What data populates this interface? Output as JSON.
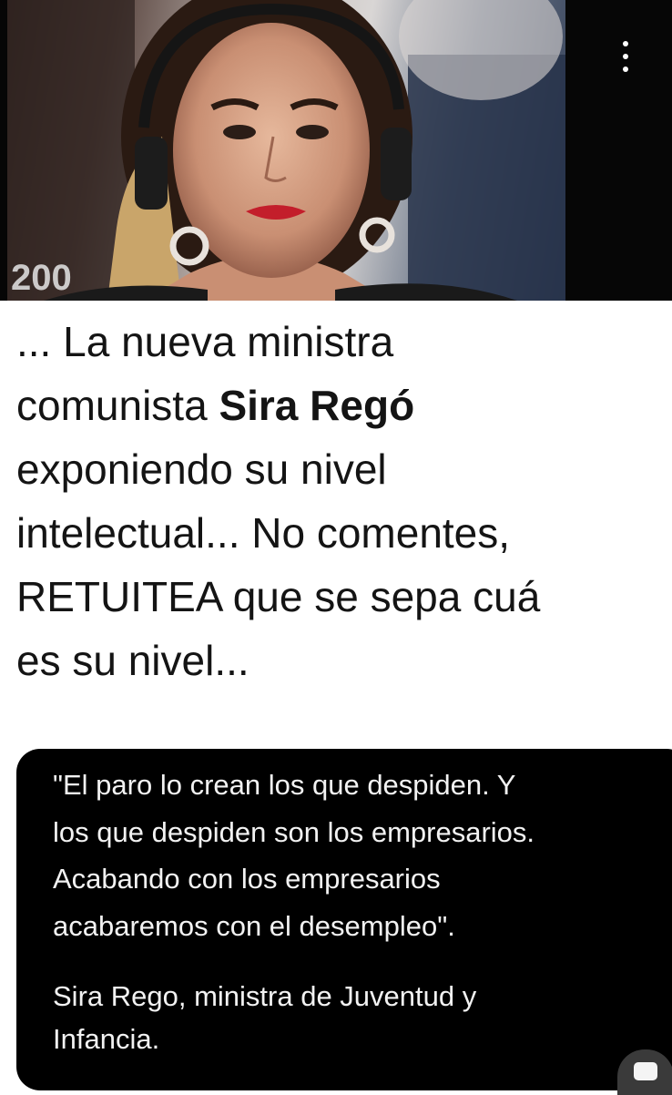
{
  "photo": {
    "overlay_text": "200"
  },
  "menu_icon": "more-vertical-icon",
  "headline": {
    "line1": "... La nueva ministra",
    "line2_pre": "comunista ",
    "line2_bold": "Sira Regó",
    "line3": "exponiendo su nivel",
    "line4": "intelectual... No comentes,",
    "line5": "RETUITEA que se sepa cuá",
    "line6": "es su nivel..."
  },
  "quote": {
    "lines": [
      "\"El paro lo crean los que despiden. Y",
      "los que despiden son los empresarios.",
      "Acabando con los empresarios",
      "acabaremos con el desempleo\"."
    ],
    "attribution": [
      "Sira Rego, ministra de Juventud y",
      "Infancia."
    ]
  },
  "chat_icon": "comment-bubble-icon"
}
